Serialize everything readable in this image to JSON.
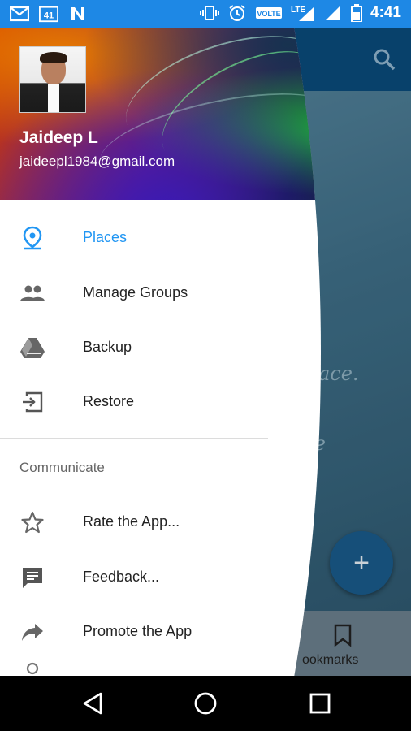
{
  "status_bar": {
    "time": "4:41",
    "left_icons": [
      "gmail-icon",
      "calendar-41-icon",
      "n-app-icon"
    ],
    "right_icons": [
      "vibrate-icon",
      "alarm-icon",
      "volte-icon",
      "lte-signal-icon",
      "signal-icon",
      "battery-icon"
    ],
    "calendar_badge": "41",
    "volte_label": "VOLTE",
    "lte_label": "LTE",
    "color": "#1e88e5"
  },
  "drawer": {
    "header": {
      "user_name": "Jaideep L",
      "user_email": "jaideepl1984@gmail.com"
    },
    "items": [
      {
        "label": "Places",
        "icon": "place-marker-icon",
        "active": true
      },
      {
        "label": "Manage Groups",
        "icon": "group-icon",
        "active": false
      },
      {
        "label": "Backup",
        "icon": "drive-icon",
        "active": false
      },
      {
        "label": "Restore",
        "icon": "login-arrow-icon",
        "active": false
      }
    ],
    "section_title": "Communicate",
    "communicate_items": [
      {
        "label": "Rate the App...",
        "icon": "star-outline-icon"
      },
      {
        "label": "Feedback...",
        "icon": "feedback-icon"
      },
      {
        "label": "Promote the App",
        "icon": "share-arrow-icon"
      }
    ],
    "accent_color": "#2196f3"
  },
  "background_app": {
    "text_line1": "any place.",
    "text_line2": "place",
    "fab_label": "+",
    "bottom_nav_label": "ookmarks"
  },
  "nav_bar": {
    "buttons": [
      "back-icon",
      "home-icon",
      "recents-icon"
    ]
  }
}
